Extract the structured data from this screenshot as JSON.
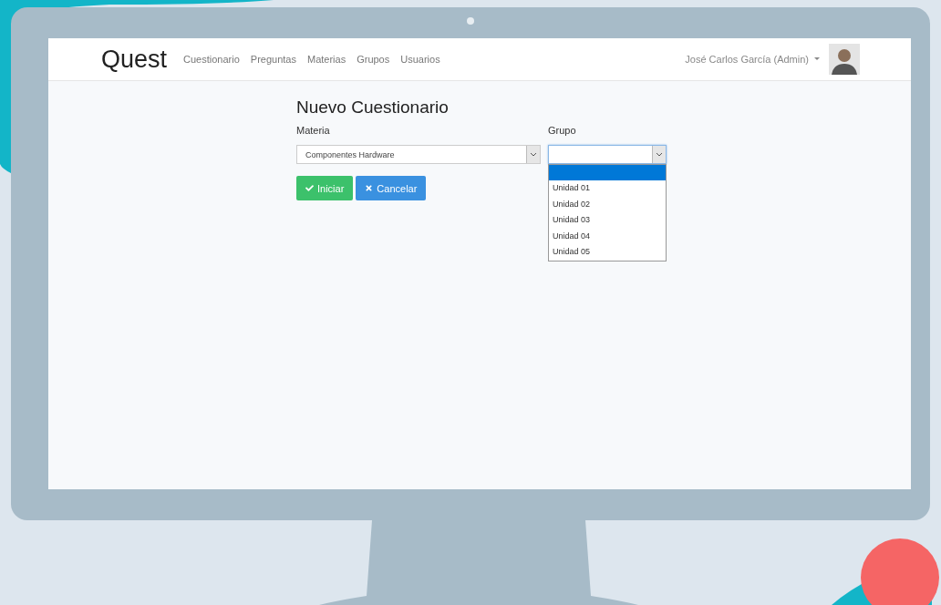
{
  "navbar": {
    "brand": "Quest",
    "links": [
      "Cuestionario",
      "Preguntas",
      "Materias",
      "Grupos",
      "Usuarios"
    ],
    "user": "José Carlos García (Admin)"
  },
  "form": {
    "title": "Nuevo Cuestionario",
    "fields": [
      {
        "label": "Materia",
        "value": "Componentes Hardware",
        "focused": false,
        "expanded": false
      },
      {
        "label": "Grupo",
        "focused": true,
        "expanded": true,
        "blank_option_highlighted": true,
        "options": [
          {
            "label": "Unidad 01",
            "selected": false
          },
          {
            "label": "Unidad 02",
            "selected": false
          },
          {
            "label": "Unidad 03",
            "selected": false
          },
          {
            "label": "Unidad 04",
            "selected": false
          },
          {
            "label": "Unidad 05",
            "selected": false
          }
        ]
      }
    ],
    "buttons": [
      {
        "kind": "primary",
        "label": "Iniciar"
      },
      {
        "kind": "cancel",
        "label": "Cancelar"
      }
    ]
  }
}
